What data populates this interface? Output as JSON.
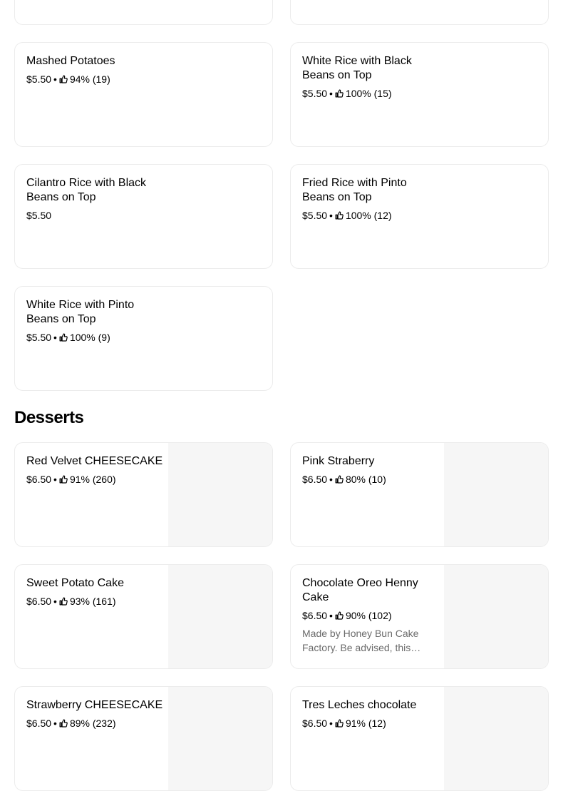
{
  "top_cards": [
    {
      "name": ""
    },
    {
      "name": ""
    }
  ],
  "sides": [
    {
      "name": "Mashed Potatoes",
      "price": "$5.50",
      "rating": "94% (19)"
    },
    {
      "name": "White Rice with Black Beans on Top",
      "price": "$5.50",
      "rating": "100% (15)"
    },
    {
      "name": "Cilantro Rice with Black Beans on Top",
      "price": "$5.50",
      "rating": ""
    },
    {
      "name": "Fried Rice with Pinto Beans on Top",
      "price": "$5.50",
      "rating": "100% (12)"
    },
    {
      "name": "White Rice with Pinto Beans on Top",
      "price": "$5.50",
      "rating": "100% (9)"
    }
  ],
  "desserts": {
    "title": "Desserts",
    "items": [
      {
        "name": "Red Velvet CHEESECAKE",
        "price": "$6.50",
        "rating": "91% (260)"
      },
      {
        "name": "Pink Straberry",
        "price": "$6.50",
        "rating": "80% (10)"
      },
      {
        "name": "Sweet Potato Cake",
        "price": "$6.50",
        "rating": "93% (161)"
      },
      {
        "name": "Chocolate Oreo Henny Cake",
        "price": "$6.50",
        "rating": "90% (102)",
        "description": "Made by Honey Bun Cake Factory. Be advised, this…"
      },
      {
        "name": "Strawberry CHEESECAKE",
        "price": "$6.50",
        "rating": "89% (232)"
      },
      {
        "name": "Tres Leches chocolate",
        "price": "$6.50",
        "rating": "91% (12)"
      }
    ]
  },
  "separator": "•",
  "icons": {
    "rating": "thumbs-up-icon"
  },
  "colors": {
    "image_placeholder": "#f6f6f6",
    "card_border": "#ececec",
    "description_text": "#6b6b6b"
  }
}
